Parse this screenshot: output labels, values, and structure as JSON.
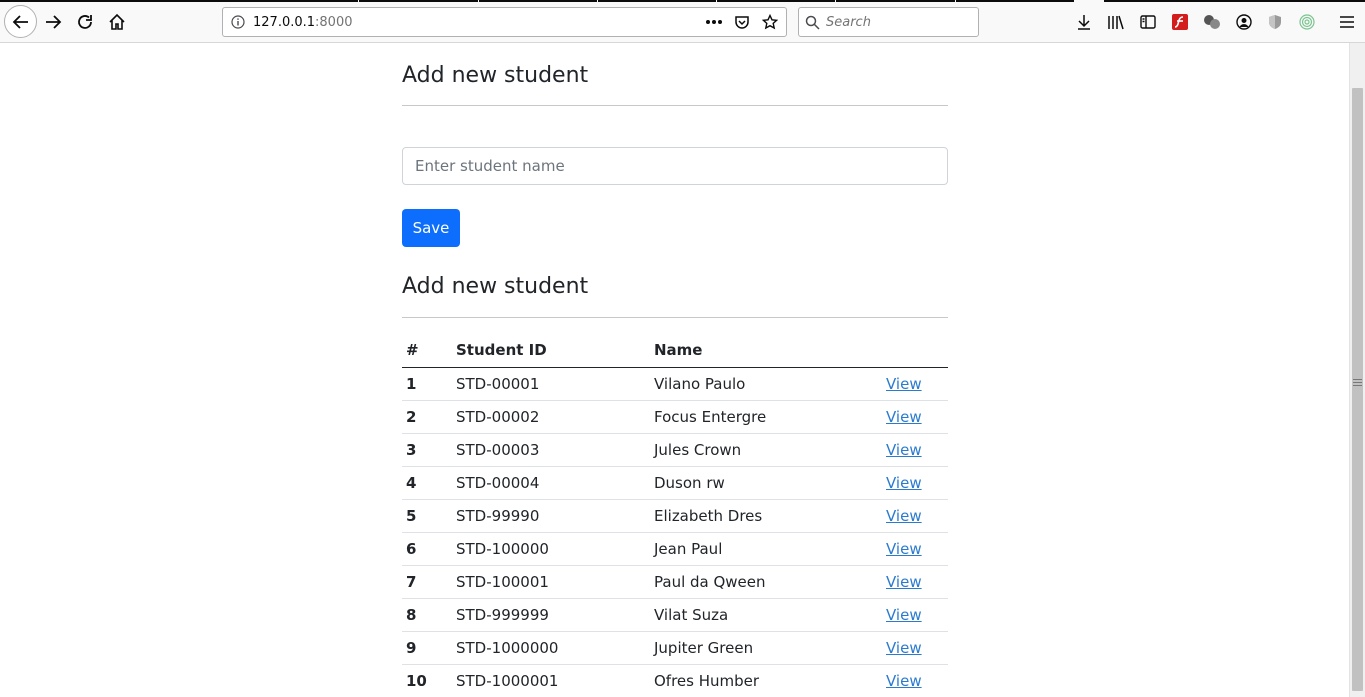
{
  "browser": {
    "url_host": "127.0.0.1",
    "url_port": ":8000",
    "search_placeholder": "Search"
  },
  "form": {
    "heading": "Add new student",
    "name_placeholder": "Enter student name",
    "save_label": "Save"
  },
  "list": {
    "heading": "Add new student",
    "columns": [
      "#",
      "Student ID",
      "Name",
      ""
    ],
    "rows": [
      {
        "num": "1",
        "id": "STD-00001",
        "name": "Vilano Paulo",
        "action": "View"
      },
      {
        "num": "2",
        "id": "STD-00002",
        "name": "Focus Entergre",
        "action": "View"
      },
      {
        "num": "3",
        "id": "STD-00003",
        "name": "Jules Crown",
        "action": "View"
      },
      {
        "num": "4",
        "id": "STD-00004",
        "name": "Duson rw",
        "action": "View"
      },
      {
        "num": "5",
        "id": "STD-99990",
        "name": "Elizabeth Dres",
        "action": "View"
      },
      {
        "num": "6",
        "id": "STD-100000",
        "name": "Jean Paul",
        "action": "View"
      },
      {
        "num": "7",
        "id": "STD-100001",
        "name": "Paul da Qween",
        "action": "View"
      },
      {
        "num": "8",
        "id": "STD-999999",
        "name": "Vilat Suza",
        "action": "View"
      },
      {
        "num": "9",
        "id": "STD-1000000",
        "name": "Jupiter Green",
        "action": "View"
      },
      {
        "num": "10",
        "id": "STD-1000001",
        "name": "Ofres Humber",
        "action": "View"
      }
    ]
  },
  "colors": {
    "primary": "#0d6efd",
    "link": "#2a7bd0",
    "text": "#212529"
  }
}
